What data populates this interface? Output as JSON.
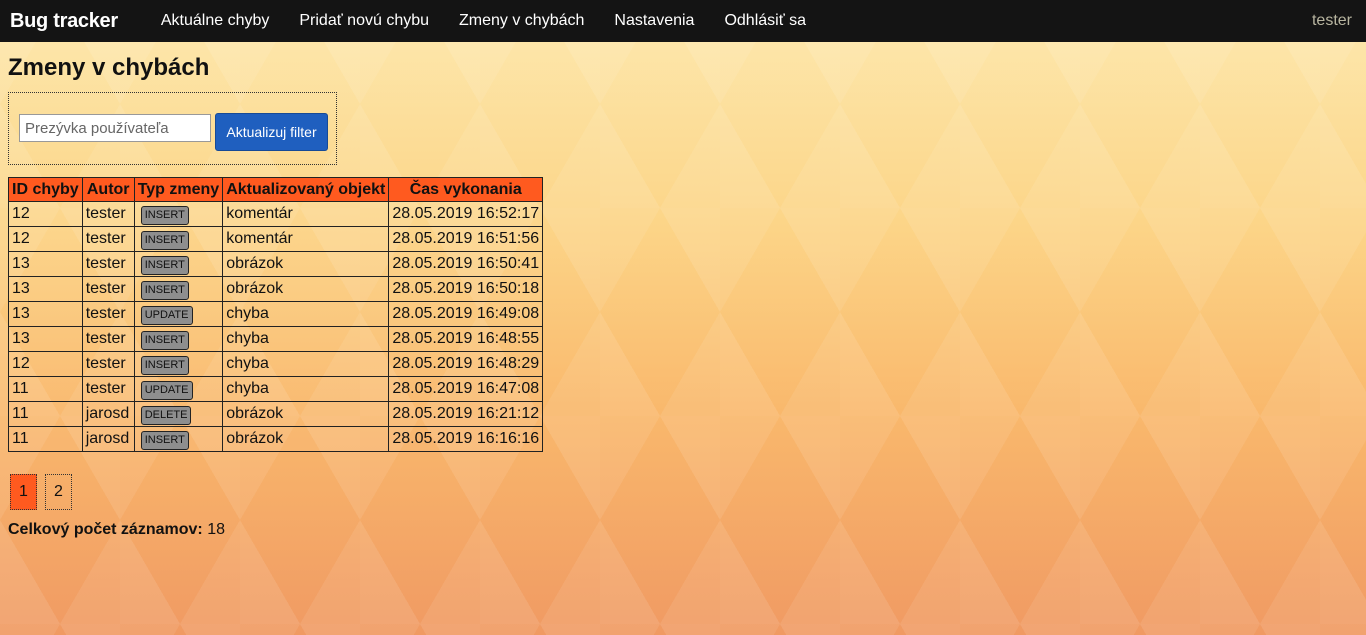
{
  "navbar": {
    "brand": "Bug tracker",
    "items": [
      {
        "label": "Aktuálne chyby"
      },
      {
        "label": "Pridať novú chybu"
      },
      {
        "label": "Zmeny v chybách"
      },
      {
        "label": "Nastavenia"
      },
      {
        "label": "Odhlásiť sa"
      }
    ],
    "user": "tester"
  },
  "page": {
    "title": "Zmeny v chybách"
  },
  "filter": {
    "placeholder": "Prezývka používateľa",
    "value": "",
    "button_label": "Aktualizuj filter"
  },
  "table": {
    "headers": [
      "ID chyby",
      "Autor",
      "Typ zmeny",
      "Aktualizovaný objekt",
      "Čas vykonania"
    ],
    "rows": [
      {
        "id": "12",
        "autor": "tester",
        "typ": "INSERT",
        "objekt": "komentár",
        "cas": "28.05.2019 16:52:17"
      },
      {
        "id": "12",
        "autor": "tester",
        "typ": "INSERT",
        "objekt": "komentár",
        "cas": "28.05.2019 16:51:56"
      },
      {
        "id": "13",
        "autor": "tester",
        "typ": "INSERT",
        "objekt": "obrázok",
        "cas": "28.05.2019 16:50:41"
      },
      {
        "id": "13",
        "autor": "tester",
        "typ": "INSERT",
        "objekt": "obrázok",
        "cas": "28.05.2019 16:50:18"
      },
      {
        "id": "13",
        "autor": "tester",
        "typ": "UPDATE",
        "objekt": "chyba",
        "cas": "28.05.2019 16:49:08"
      },
      {
        "id": "13",
        "autor": "tester",
        "typ": "INSERT",
        "objekt": "chyba",
        "cas": "28.05.2019 16:48:55"
      },
      {
        "id": "12",
        "autor": "tester",
        "typ": "INSERT",
        "objekt": "chyba",
        "cas": "28.05.2019 16:48:29"
      },
      {
        "id": "11",
        "autor": "tester",
        "typ": "UPDATE",
        "objekt": "chyba",
        "cas": "28.05.2019 16:47:08"
      },
      {
        "id": "11",
        "autor": "jarosd",
        "typ": "DELETE",
        "objekt": "obrázok",
        "cas": "28.05.2019 16:21:12"
      },
      {
        "id": "11",
        "autor": "jarosd",
        "typ": "INSERT",
        "objekt": "obrázok",
        "cas": "28.05.2019 16:16:16"
      }
    ]
  },
  "pagination": {
    "pages": [
      "1",
      "2"
    ],
    "active": "1"
  },
  "summary": {
    "label": "Celkový počet záznamov:",
    "value": "18"
  },
  "colors": {
    "navbar_bg": "#141414",
    "accent": "#ff5a1f",
    "button": "#1f5fbf",
    "badge": "#8e8e8e"
  }
}
